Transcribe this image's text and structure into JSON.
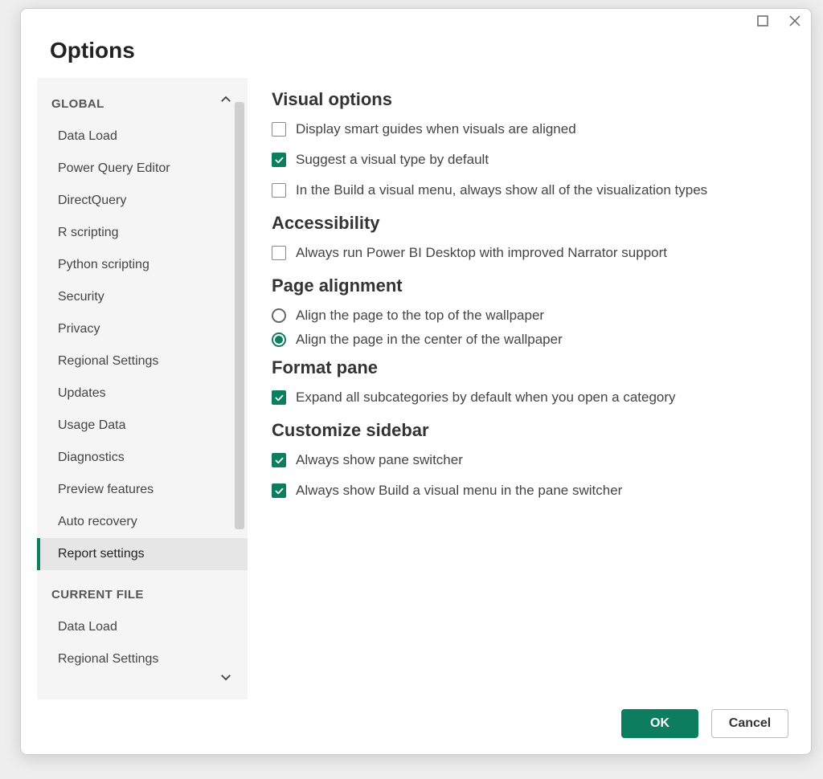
{
  "dialog": {
    "title": "Options"
  },
  "sidebar": {
    "global": {
      "header": "GLOBAL",
      "items": [
        "Data Load",
        "Power Query Editor",
        "DirectQuery",
        "R scripting",
        "Python scripting",
        "Security",
        "Privacy",
        "Regional Settings",
        "Updates",
        "Usage Data",
        "Diagnostics",
        "Preview features",
        "Auto recovery",
        "Report settings"
      ],
      "selected_index": 13
    },
    "current_file": {
      "header": "CURRENT FILE",
      "items": [
        "Data Load",
        "Regional Settings"
      ]
    }
  },
  "main": {
    "visual_options": {
      "title": "Visual options",
      "opt0": "Display smart guides when visuals are aligned",
      "opt1": "Suggest a visual type by default",
      "opt2": "In the Build a visual menu, always show all of the visualization types"
    },
    "accessibility": {
      "title": "Accessibility",
      "opt0": "Always run Power BI Desktop with improved Narrator support"
    },
    "page_alignment": {
      "title": "Page alignment",
      "opt0": "Align the page to the top of the wallpaper",
      "opt1": "Align the page in the center of the wallpaper"
    },
    "format_pane": {
      "title": "Format pane",
      "opt0": "Expand all subcategories by default when you open a category"
    },
    "customize_sidebar": {
      "title": "Customize sidebar",
      "opt0": "Always show pane switcher",
      "opt1": "Always show Build a visual menu in the pane switcher"
    }
  },
  "footer": {
    "ok": "OK",
    "cancel": "Cancel"
  }
}
